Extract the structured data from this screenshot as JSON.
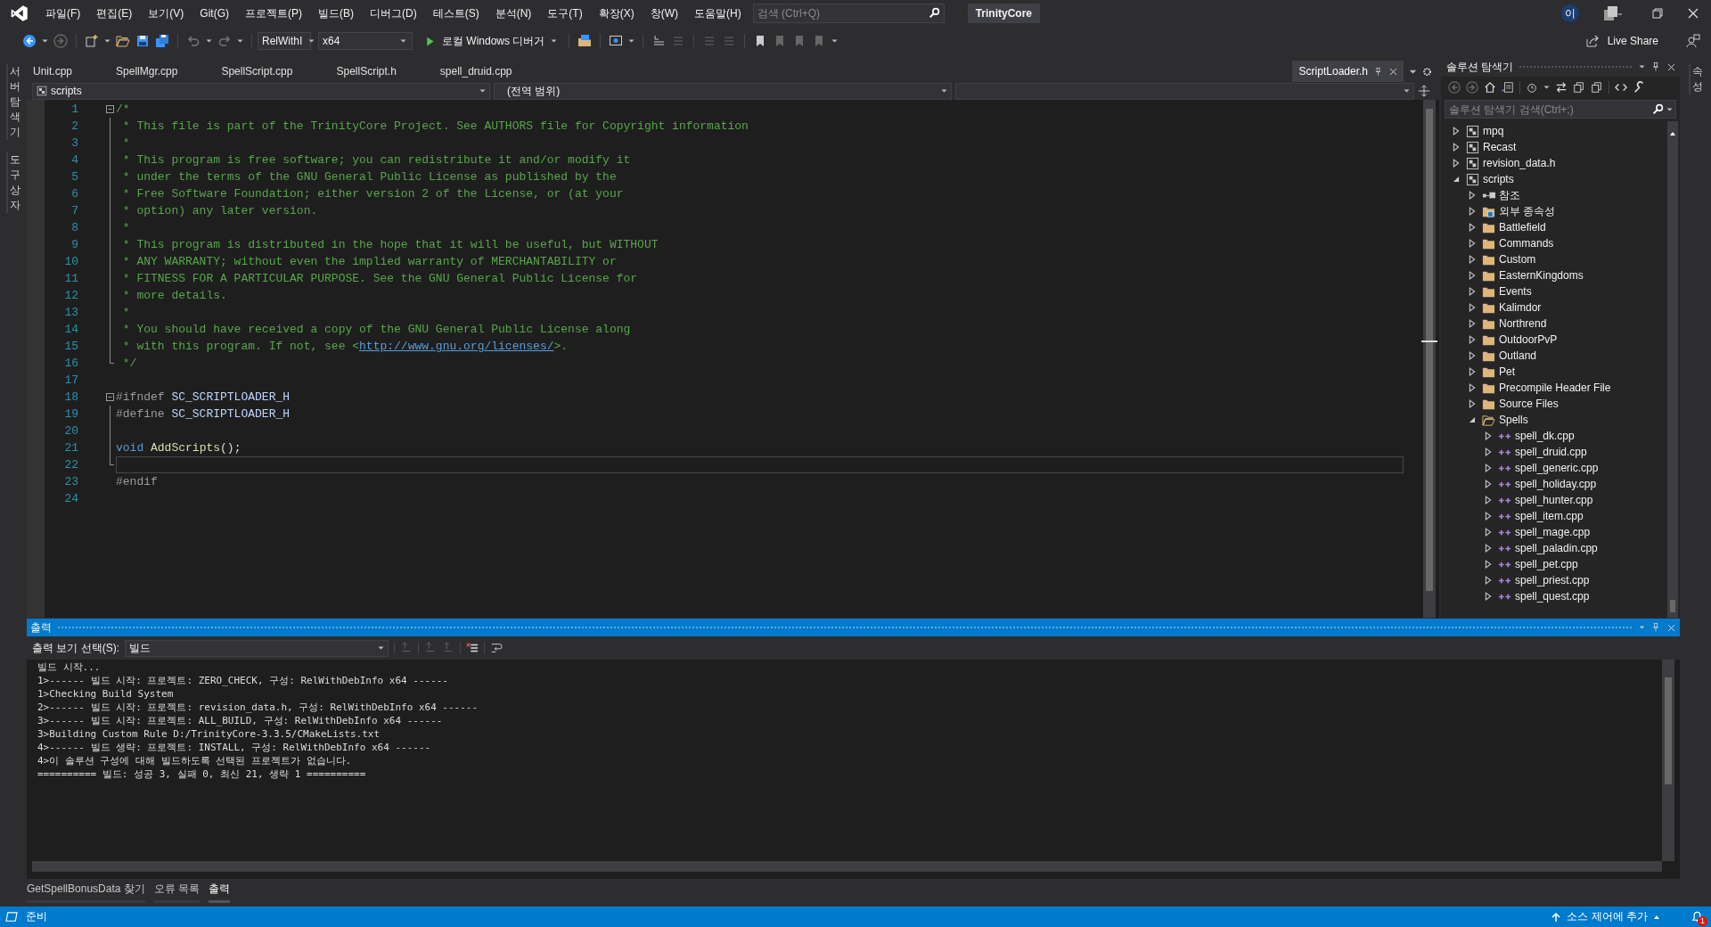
{
  "menu": [
    "파일(F)",
    "편집(E)",
    "보기(V)",
    "Git(G)",
    "프로젝트(P)",
    "빌드(B)",
    "디버그(D)",
    "테스트(S)",
    "분석(N)",
    "도구(T)",
    "확장(X)",
    "창(W)",
    "도움말(H)"
  ],
  "search": {
    "placeholder": "검색 (Ctrl+Q)"
  },
  "solution_name": "TrinityCore",
  "account": "이",
  "toolbar": {
    "configuration": "RelWithI",
    "platform": "x64",
    "debugger": "로컬 Windows 디버거",
    "live_share": "Live Share"
  },
  "left_tabs": [
    "서버 탐색기",
    "도구 상자"
  ],
  "right_tabs": [
    "속성"
  ],
  "doc_tabs": [
    {
      "label": "Unit.cpp",
      "selected": false
    },
    {
      "label": "SpellMgr.cpp",
      "selected": false
    },
    {
      "label": "SpellScript.cpp",
      "selected": false
    },
    {
      "label": "SpellScript.h",
      "selected": false
    },
    {
      "label": "spell_druid.cpp",
      "selected": false
    },
    {
      "label": "ScriptLoader.h",
      "selected": true
    }
  ],
  "nav_bar": {
    "project": "scripts",
    "scope": "(전역 범위)"
  },
  "code_lines": [
    {
      "number": "1",
      "fold": true,
      "current": false,
      "tokens": [
        {
          "kind": "comment",
          "text": "/*"
        }
      ]
    },
    {
      "number": "2",
      "fold": false,
      "current": false,
      "tokens": [
        {
          "kind": "comment",
          "text": " * This file is part of the TrinityCore Project. See AUTHORS file for Copyright information"
        }
      ]
    },
    {
      "number": "3",
      "fold": false,
      "current": false,
      "tokens": [
        {
          "kind": "comment",
          "text": " *"
        }
      ]
    },
    {
      "number": "4",
      "fold": false,
      "current": false,
      "tokens": [
        {
          "kind": "comment",
          "text": " * This program is free software; you can redistribute it and/or modify it"
        }
      ]
    },
    {
      "number": "5",
      "fold": false,
      "current": false,
      "tokens": [
        {
          "kind": "comment",
          "text": " * under the terms of the GNU General Public License as published by the"
        }
      ]
    },
    {
      "number": "6",
      "fold": false,
      "current": false,
      "tokens": [
        {
          "kind": "comment",
          "text": " * Free Software Foundation; either version 2 of the License, or (at your"
        }
      ]
    },
    {
      "number": "7",
      "fold": false,
      "current": false,
      "tokens": [
        {
          "kind": "comment",
          "text": " * option) any later version."
        }
      ]
    },
    {
      "number": "8",
      "fold": false,
      "current": false,
      "tokens": [
        {
          "kind": "comment",
          "text": " *"
        }
      ]
    },
    {
      "number": "9",
      "fold": false,
      "current": false,
      "tokens": [
        {
          "kind": "comment",
          "text": " * This program is distributed in the hope that it will be useful, but WITHOUT"
        }
      ]
    },
    {
      "number": "10",
      "fold": false,
      "current": false,
      "tokens": [
        {
          "kind": "comment",
          "text": " * ANY WARRANTY; without even the implied warranty of MERCHANTABILITY or"
        }
      ]
    },
    {
      "number": "11",
      "fold": false,
      "current": false,
      "tokens": [
        {
          "kind": "comment",
          "text": " * FITNESS FOR A PARTICULAR PURPOSE. See the GNU General Public License for"
        }
      ]
    },
    {
      "number": "12",
      "fold": false,
      "current": false,
      "tokens": [
        {
          "kind": "comment",
          "text": " * more details."
        }
      ]
    },
    {
      "number": "13",
      "fold": false,
      "current": false,
      "tokens": [
        {
          "kind": "comment",
          "text": " *"
        }
      ]
    },
    {
      "number": "14",
      "fold": false,
      "current": false,
      "tokens": [
        {
          "kind": "comment",
          "text": " * You should have received a copy of the GNU General Public License along"
        }
      ]
    },
    {
      "number": "15",
      "fold": false,
      "current": false,
      "tokens": [
        {
          "kind": "comment",
          "text": " * with this program. If not, see <"
        },
        {
          "kind": "link",
          "text": "http://www.gnu.org/licenses/"
        },
        {
          "kind": "comment",
          "text": ">."
        }
      ]
    },
    {
      "number": "16",
      "fold": false,
      "current": false,
      "tokens": [
        {
          "kind": "comment",
          "text": " */"
        }
      ]
    },
    {
      "number": "17",
      "fold": false,
      "current": false
    },
    {
      "number": "18",
      "fold": true,
      "current": false,
      "tokens": [
        {
          "kind": "preproc",
          "text": "#ifndef"
        },
        {
          "kind": "macro",
          "text": " SC_SCRIPTLOADER_H"
        }
      ]
    },
    {
      "number": "19",
      "fold": false,
      "current": false,
      "tokens": [
        {
          "kind": "preproc",
          "text": "#define"
        },
        {
          "kind": "macro",
          "text": " SC_SCRIPTLOADER_H"
        }
      ]
    },
    {
      "number": "20",
      "fold": false,
      "current": false
    },
    {
      "number": "21",
      "fold": false,
      "current": false,
      "tokens": [
        {
          "kind": "keyword",
          "text": "void"
        },
        {
          "kind": "function",
          "text": " AddScripts"
        },
        {
          "kind": "plain",
          "text": "();"
        }
      ]
    },
    {
      "number": "22",
      "fold": false,
      "current": true
    },
    {
      "number": "23",
      "fold": false,
      "current": false,
      "tokens": [
        {
          "kind": "preproc",
          "text": "#endif"
        }
      ]
    },
    {
      "number": "24",
      "fold": false,
      "current": false
    }
  ],
  "solution_explorer": {
    "title": "솔루션 탐색기",
    "search": {
      "placeholder": "솔루션 탐색기 검색(Ctrl+;)"
    },
    "tree": [
      {
        "label": "mpq",
        "kind": "project",
        "expanded": false
      },
      {
        "label": "Recast",
        "kind": "project",
        "expanded": false
      },
      {
        "label": "revision_data.h",
        "kind": "project",
        "expanded": false
      },
      {
        "label": "scripts",
        "kind": "project",
        "expanded": true,
        "children": [
          {
            "label": "참조",
            "kind": "references",
            "expanded": false
          },
          {
            "label": "외부 종속성",
            "kind": "external",
            "expanded": false
          },
          {
            "label": "Battlefield",
            "kind": "folder",
            "expanded": false
          },
          {
            "label": "Commands",
            "kind": "folder",
            "expanded": false
          },
          {
            "label": "Custom",
            "kind": "folder",
            "expanded": false
          },
          {
            "label": "EasternKingdoms",
            "kind": "folder",
            "expanded": false
          },
          {
            "label": "Events",
            "kind": "folder",
            "expanded": false
          },
          {
            "label": "Kalimdor",
            "kind": "folder",
            "expanded": false
          },
          {
            "label": "Northrend",
            "kind": "folder",
            "expanded": false
          },
          {
            "label": "OutdoorPvP",
            "kind": "folder",
            "expanded": false
          },
          {
            "label": "Outland",
            "kind": "folder",
            "expanded": false
          },
          {
            "label": "Pet",
            "kind": "folder",
            "expanded": false
          },
          {
            "label": "Precompile Header File",
            "kind": "folder",
            "expanded": false
          },
          {
            "label": "Source Files",
            "kind": "folder",
            "expanded": false
          },
          {
            "label": "Spells",
            "kind": "folder",
            "expanded": true,
            "children": [
              {
                "label": "spell_dk.cpp",
                "kind": "cpp",
                "expanded": false
              },
              {
                "label": "spell_druid.cpp",
                "kind": "cpp",
                "expanded": false
              },
              {
                "label": "spell_generic.cpp",
                "kind": "cpp",
                "expanded": false
              },
              {
                "label": "spell_holiday.cpp",
                "kind": "cpp",
                "expanded": false
              },
              {
                "label": "spell_hunter.cpp",
                "kind": "cpp",
                "expanded": false
              },
              {
                "label": "spell_item.cpp",
                "kind": "cpp",
                "expanded": false
              },
              {
                "label": "spell_mage.cpp",
                "kind": "cpp",
                "expanded": false
              },
              {
                "label": "spell_paladin.cpp",
                "kind": "cpp",
                "expanded": false
              },
              {
                "label": "spell_pet.cpp",
                "kind": "cpp",
                "expanded": false
              },
              {
                "label": "spell_priest.cpp",
                "kind": "cpp",
                "expanded": false
              },
              {
                "label": "spell_quest.cpp",
                "kind": "cpp",
                "expanded": false
              }
            ]
          }
        ]
      }
    ]
  },
  "output": {
    "title": "출력",
    "source_label": "출력 보기 선택(S):",
    "source": "빌드",
    "lines": [
      "빌드 시작...",
      "1>------ 빌드 시작: 프로젝트: ZERO_CHECK, 구성: RelWithDebInfo x64 ------",
      "1>Checking Build System",
      "2>------ 빌드 시작: 프로젝트: revision_data.h, 구성: RelWithDebInfo x64 ------",
      "3>------ 빌드 시작: 프로젝트: ALL_BUILD, 구성: RelWithDebInfo x64 ------",
      "3>Building Custom Rule D:/TrinityCore-3.3.5/CMakeLists.txt",
      "4>------ 빌드 생략: 프로젝트: INSTALL, 구성: RelWithDebInfo x64 ------",
      "4>이 솔루션 구성에 대해 빌드하도록 선택된 프로젝트가 없습니다.",
      "========== 빌드: 성공 3, 실패 0, 최신 21, 생략 1 =========="
    ]
  },
  "bottom_tabs": [
    {
      "label": "GetSpellBonusData 찾기",
      "selected": false
    },
    {
      "label": "오류 목록",
      "selected": false
    },
    {
      "label": "출력",
      "selected": true
    }
  ],
  "status_bar": {
    "text": "준비",
    "source_control": "소스 제어에 추가",
    "notifications": "1"
  }
}
